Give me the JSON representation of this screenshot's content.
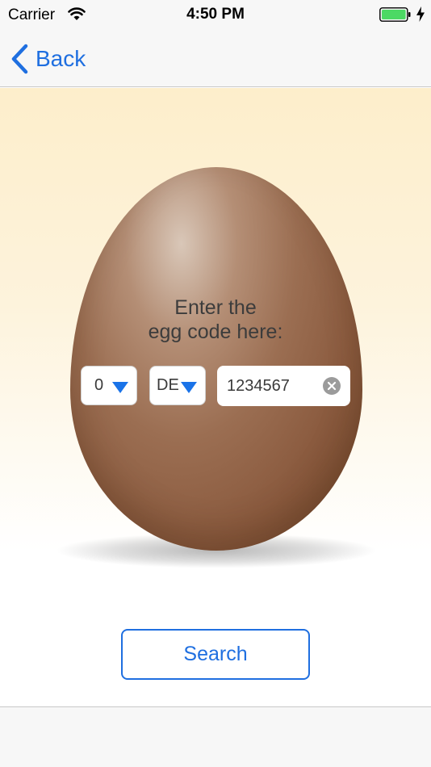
{
  "status_bar": {
    "carrier": "Carrier",
    "time": "4:50 PM",
    "battery_color": "#4cd964"
  },
  "nav": {
    "back_label": "Back"
  },
  "egg_form": {
    "prompt_line1": "Enter the",
    "prompt_line2": "egg code here:",
    "production_type": "0",
    "country_code": "DE",
    "code_value": "1234567"
  },
  "actions": {
    "search_label": "Search"
  },
  "colors": {
    "accent": "#1f6fe0",
    "picker_arrow": "#1a73e8"
  }
}
